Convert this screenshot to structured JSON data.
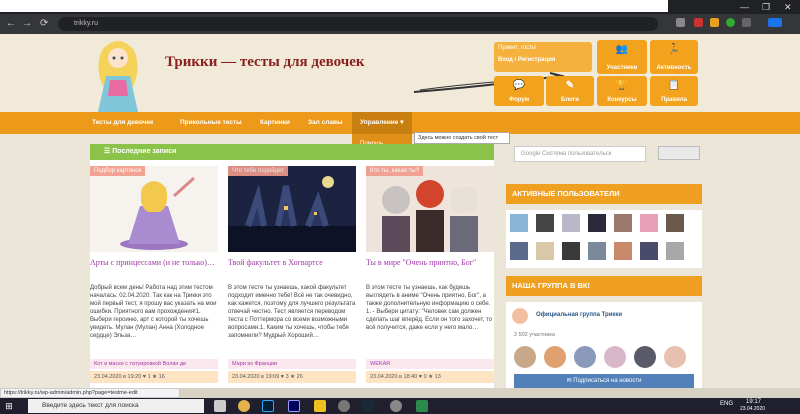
{
  "browser": {
    "url": "trikky.ru",
    "nav": {
      "back": "←",
      "forward": "→",
      "reload": "⟳"
    },
    "window_controls": [
      "—",
      "❐",
      "✕"
    ]
  },
  "site": {
    "title": "Трикки — тесты для девочек",
    "greeting": "Привет, гость!",
    "greeting_sub": "Вход / Регистрация",
    "header_buttons": [
      {
        "label": "Участники",
        "icon": "users-icon",
        "glyph": "👥"
      },
      {
        "label": "Активность",
        "icon": "activity-icon",
        "glyph": "🏃"
      },
      {
        "label": "Форум",
        "icon": "forum-icon",
        "glyph": "💬"
      },
      {
        "label": "Блоги",
        "icon": "blogs-icon",
        "glyph": "✎"
      },
      {
        "label": "Конкурсы",
        "icon": "contests-icon",
        "glyph": "🏆"
      },
      {
        "label": "Правила",
        "icon": "rules-icon",
        "glyph": "📋"
      }
    ]
  },
  "menu": {
    "items": [
      "Тесты для девочек",
      "Прикольные тесты",
      "Картинки",
      "Зал славы",
      "Управление"
    ],
    "dropdown_item": "Помощь",
    "tooltip": "Здесь можно создать свой тест"
  },
  "content": {
    "section_title": "Последние записи",
    "posts": [
      {
        "tag": "Подбор картинок",
        "title": "Арты с принцессами (и не только)…",
        "excerpt": "Добрый всем день! Работа над этим тестом началась: 02.04.2020. Так как на Трикки это мой первый тест, я прошу вас указать на мои ошибки. Приятного вам прохождения!1. Выбери героиню, арт с которой ты хочешь увидеть. Мулан (Мулан) Анна (Холодное сердце) Эльза…",
        "author": "Кот в маске с татуировкой Волан де",
        "meta": "23.04.2020 в 19:20  ♥ 1  ★ 16"
      },
      {
        "tag": "Что тебе подойдет",
        "title": "Твой факультет в Хогвартсе",
        "excerpt": "В этом тесте ты узнаешь, какой факультет подходит именно тебе! Всё не так очевидно, как кажется, поэтому для лучшего результата отвечай честно. Тест является переводом теста с Поттермора со всеми возможными вопросами.1. Каким ты хочешь, чтобы тебя запомнили? Мудрый Хороший…",
        "author": "Мари из Франции",
        "meta": "23.04.2020 в 19:09  ♥ 3  ★ 26"
      },
      {
        "tag": "Кто ты, какая ты?",
        "title": "Ты в мире \"Очень приятно, Бог\"",
        "excerpt": "В этом тесте ты узнаешь, как будешь выглядеть в аниме \"Очень приятно, Бог\", а также дополнительную информацию о себе. 1. - Выбери цитату: \"Человек сам должен сделать шаг вперёд. Если он того захочет, то всё получится, даже если у него мало…",
        "author": "WEKAR",
        "meta": "23.04.2020 в 18:40  ♥ 0  ★ 13"
      }
    ]
  },
  "sidebar": {
    "search_placeholder": "Google Система пользовательск",
    "search_button": "",
    "active_users_title": "АКТИВНЫЕ ПОЛЬЗОВАТЕЛИ",
    "group_title": "НАША ГРУППА В ВК!",
    "group_name": "Официальная группа Трикки",
    "group_members": "2 502 участника",
    "subscribe": "Подписаться на новости"
  },
  "statusbar": "https://trikky.ru/wp-admin/admin.php?page=testme-edit",
  "taskbar": {
    "search": "Введите здесь текст для поиска",
    "lang": "ENG",
    "time": "19:17",
    "date": "23.04.2020"
  }
}
